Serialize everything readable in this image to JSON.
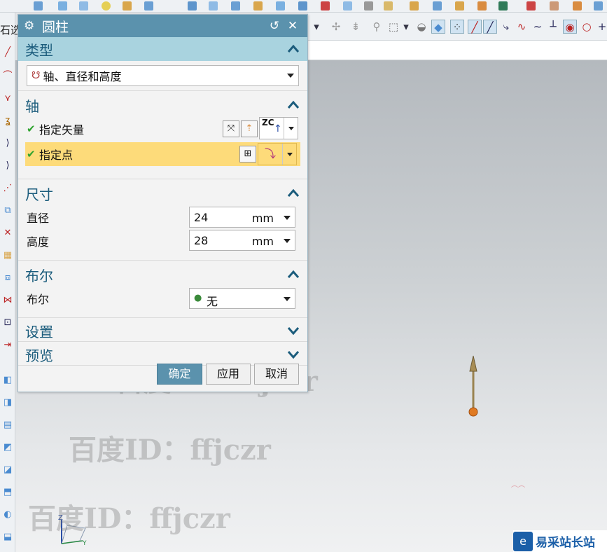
{
  "left_toolbar_partial_label": "石选",
  "dialog": {
    "title": "圆柱",
    "type_section": {
      "header": "类型",
      "dropdown_value": "轴、直径和高度"
    },
    "axis_section": {
      "header": "轴",
      "specify_vector_label": "指定矢量",
      "vector_button_label": "ZC",
      "specify_point_label": "指定点"
    },
    "dimensions_section": {
      "header": "尺寸",
      "diameter_label": "直径",
      "diameter_value": "24",
      "diameter_unit": "mm",
      "height_label": "高度",
      "height_value": "28",
      "height_unit": "mm"
    },
    "boolean_section": {
      "header": "布尔",
      "label": "布尔",
      "value": "无"
    },
    "settings_section": {
      "header": "设置"
    },
    "preview_section": {
      "header": "预览"
    },
    "buttons": {
      "ok": "确定",
      "apply": "应用",
      "cancel": "取消"
    }
  },
  "watermark_text": "百度ID：ffjczr",
  "brand_text": "易采站长站",
  "colors": {
    "accent": "#5b92ad",
    "section_active": "#a9d3df",
    "highlight_row": "#fddb7a",
    "check_green": "#2ea32e"
  }
}
